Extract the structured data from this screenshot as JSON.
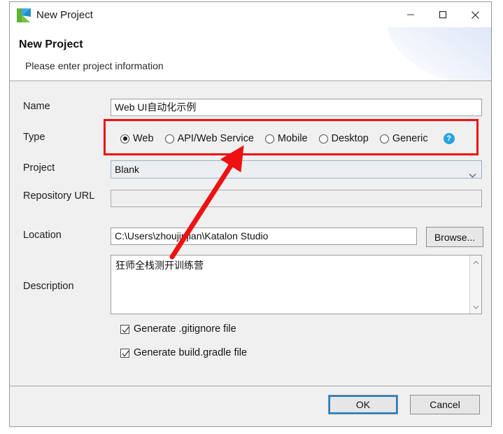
{
  "window": {
    "title": "New Project",
    "icon": "katalon-logo-icon",
    "controls": {
      "minimize": "minimize-icon",
      "maximize": "maximize-icon",
      "close": "close-icon"
    }
  },
  "header": {
    "title": "New Project",
    "subtitle": "Please enter project information"
  },
  "form": {
    "name": {
      "label": "Name",
      "value": "Web UI自动化示例"
    },
    "type": {
      "label": "Type",
      "options": [
        {
          "label": "Web",
          "selected": true
        },
        {
          "label": "API/Web Service",
          "selected": false
        },
        {
          "label": "Mobile",
          "selected": false
        },
        {
          "label": "Desktop",
          "selected": false
        },
        {
          "label": "Generic",
          "selected": false
        }
      ],
      "help": "?"
    },
    "project": {
      "label": "Project",
      "value": "Blank"
    },
    "repository": {
      "label": "Repository URL",
      "value": ""
    },
    "location": {
      "label": "Location",
      "value": "C:\\Users\\zhoujinjian\\Katalon Studio",
      "browse_label": "Browse..."
    },
    "description": {
      "label": "Description",
      "value": "狂师全栈测开训练营"
    },
    "checkboxes": [
      {
        "label": "Generate .gitignore file",
        "checked": true
      },
      {
        "label": "Generate build.gradle file",
        "checked": true
      }
    ]
  },
  "footer": {
    "ok_label": "OK",
    "cancel_label": "Cancel"
  },
  "colors": {
    "annotation": "#ee1111",
    "accent": "#1a7fd4",
    "help": "#29a3e0"
  }
}
